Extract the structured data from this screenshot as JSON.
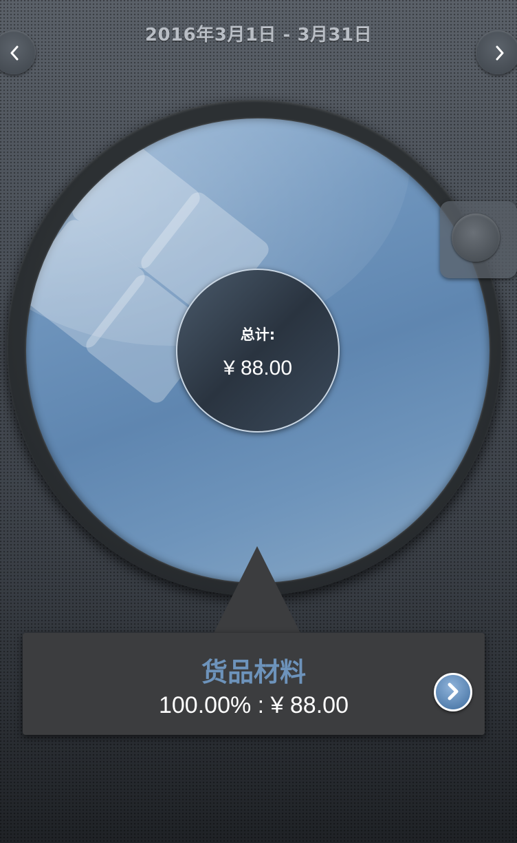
{
  "header": {
    "date_range": "2016年3月1日 - 3月31日"
  },
  "nav": {
    "prev_icon": "chevron-left-icon",
    "next_icon": "chevron-right-icon"
  },
  "summary": {
    "label": "总计:",
    "total": "¥ 88.00"
  },
  "selected_category": {
    "name": "货品材料",
    "share_and_amount": "100.00% : ¥ 88.00"
  },
  "chart_data": {
    "type": "pie",
    "slices": [
      {
        "label": "货品材料",
        "percent": 100.0,
        "value": 88.0
      }
    ],
    "total": 88.0
  },
  "colors": {
    "slice": "#6f95bd",
    "category_title": "#6d93bb",
    "callout_bg": "#3c3d3f"
  }
}
